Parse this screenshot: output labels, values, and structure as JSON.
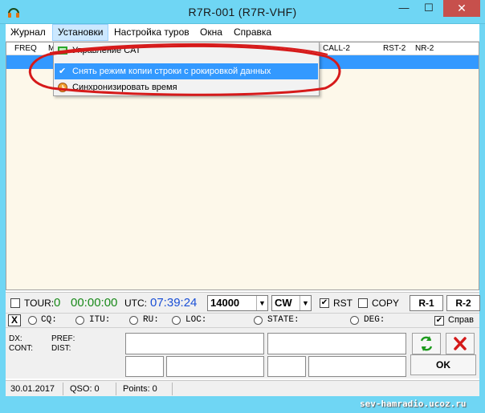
{
  "window": {
    "title": "R7R-001  (R7R-VHF)",
    "min_label": "—",
    "max_label": "☐",
    "close_label": "✕"
  },
  "menu": {
    "items": [
      "Журнал",
      "Установки",
      "Настройка туров",
      "Окна",
      "Справка"
    ]
  },
  "dropdown": {
    "items": [
      {
        "label": "Управление CAT",
        "icon": "cat-control-icon"
      },
      {
        "label": "Снять режим копии строки с рокировкой данных",
        "checked": true
      },
      {
        "label": "Синхронизировать время",
        "icon": "clock-icon"
      }
    ]
  },
  "grid": {
    "headers": [
      "FREQ",
      "M",
      "CALL-2",
      "RST-2",
      "NR-2"
    ]
  },
  "toolbar1": {
    "tour_label": "TOUR:",
    "tour_value": "0",
    "timer": "00:00:00",
    "utc_label": "UTC:",
    "utc_value": "07:39:24",
    "freq_value": "14000",
    "mode_value": "CW",
    "rst_label": "RST",
    "rst_checked": true,
    "copy_label": "COPY",
    "copy_checked": false,
    "r1_label": "R-1",
    "r2_label": "R-2"
  },
  "toolbar2": {
    "x_label": "X",
    "radios": [
      "CQ:",
      "ITU:",
      "RU:",
      "LOC:",
      "STATE:",
      "DEG:"
    ],
    "spravka_label": "Справ"
  },
  "info": {
    "dx_label": "DX:",
    "cont_label": "CONT:",
    "pref_label": "PREF:",
    "dist_label": "DIST:",
    "ok_label": "OK"
  },
  "status": {
    "date": "30.01.2017",
    "qso": "QSO: 0",
    "points": "Points: 0"
  },
  "watermark": "sev-hamradio.ucoz.ru",
  "colors": {
    "titlebar": "#6fd6f4",
    "selection": "#3399ff",
    "timer_green": "#1a8a1a",
    "utc_blue": "#1a4fd6",
    "annotation_red": "#d61a1a",
    "close": "#c7504c"
  }
}
